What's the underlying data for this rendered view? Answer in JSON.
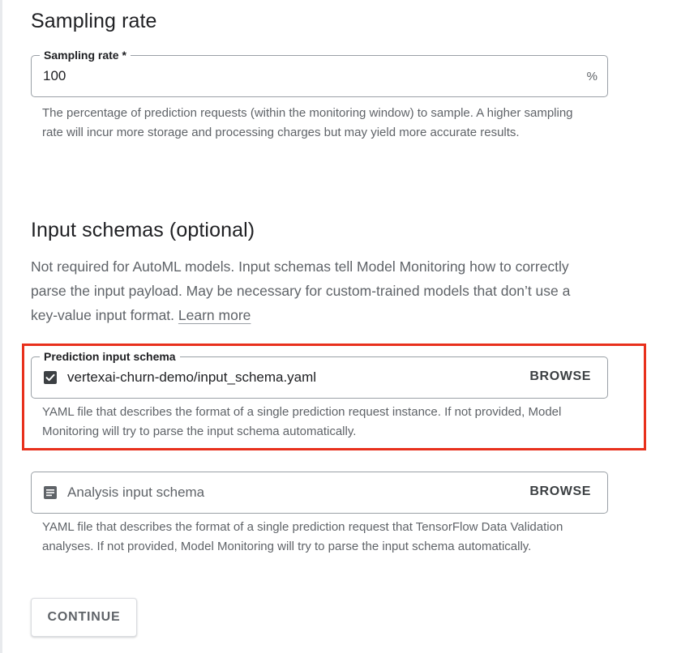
{
  "sampling": {
    "heading": "Sampling rate",
    "field_label": "Sampling rate *",
    "value": "100",
    "suffix": "%",
    "helper": "The percentage of prediction requests (within the monitoring window) to sample. A higher sampling rate will incur more storage and processing charges but may yield more accurate results."
  },
  "schemas": {
    "heading": "Input schemas (optional)",
    "description": "Not required for AutoML models. Input schemas tell Model Monitoring how to correctly parse the input payload. May be necessary for custom-trained models that don’t use a key-value input format.",
    "learn_more": "Learn more",
    "prediction": {
      "label": "Prediction input schema",
      "value": "vertexai-churn-demo/input_schema.yaml",
      "icon": "file-check-icon",
      "browse": "BROWSE",
      "helper": "YAML file that describes the format of a single prediction request instance. If not provided, Model Monitoring will try to parse the input schema automatically."
    },
    "analysis": {
      "placeholder": "Analysis input schema",
      "icon": "document-icon",
      "browse": "BROWSE",
      "helper": "YAML file that describes the format of a single prediction request that TensorFlow Data Validation analyses. If not provided, Model Monitoring will try to parse the input schema automatically."
    }
  },
  "actions": {
    "continue": "CONTINUE"
  },
  "colors": {
    "highlight": "#e8301c",
    "border": "#9aa0a6",
    "text": "#202124",
    "secondary_text": "#5f6368"
  }
}
